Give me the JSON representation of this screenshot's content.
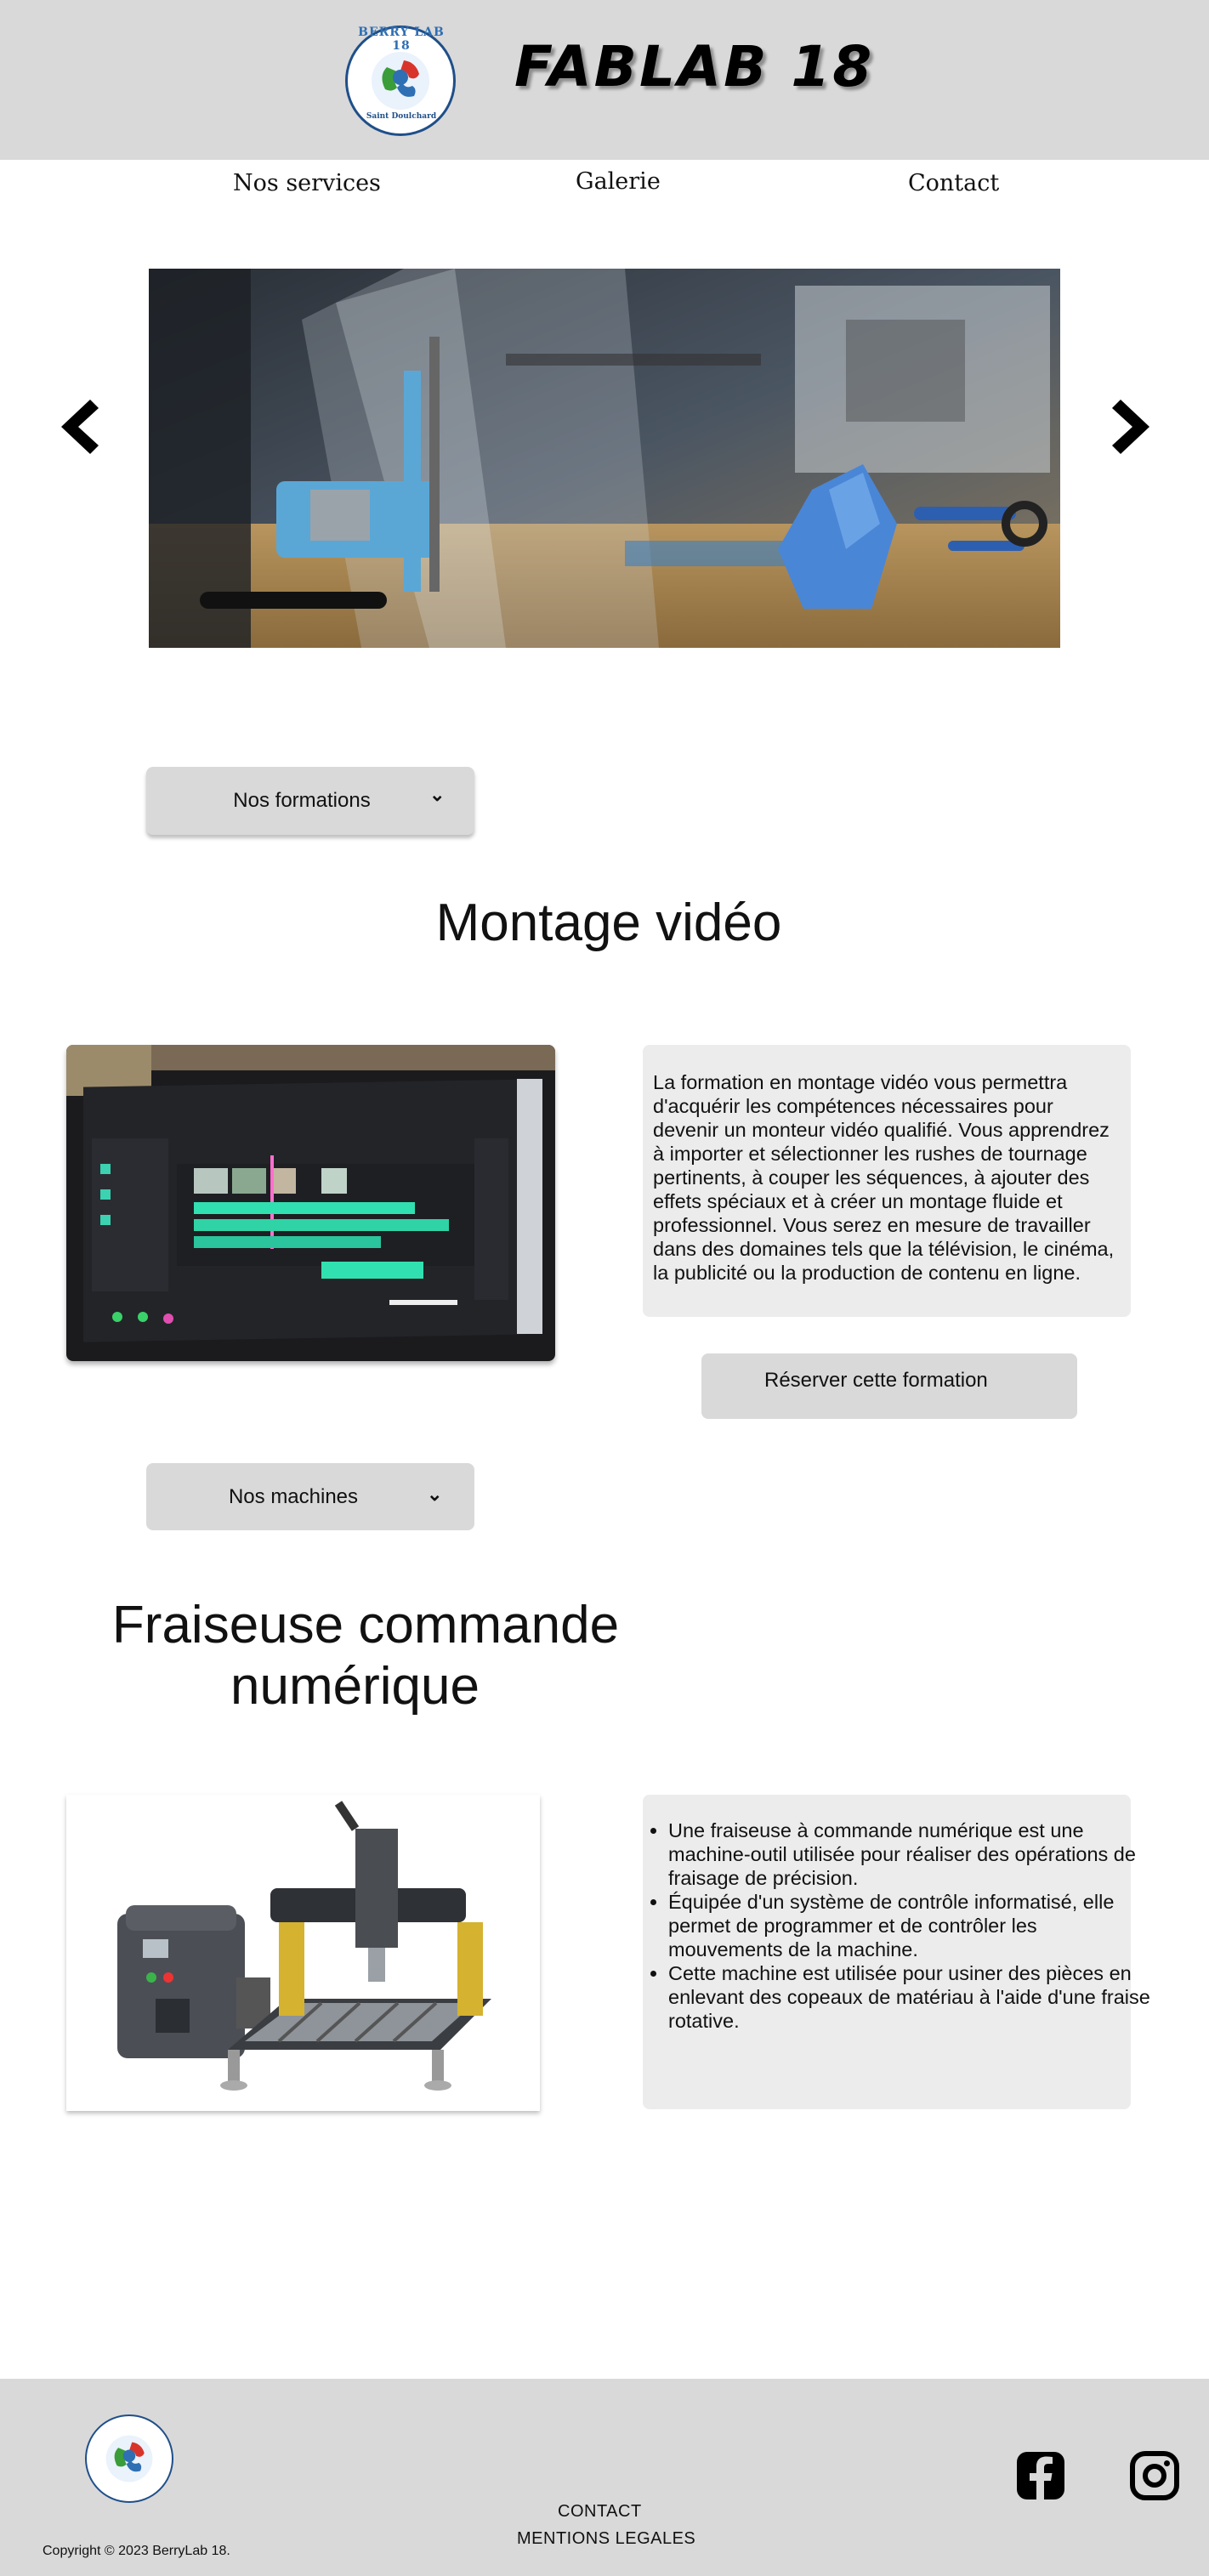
{
  "header": {
    "site_title": "FABLAB 18",
    "logo_text": "BERRY LAB 18",
    "logo_subtext": "Saint Doulchard"
  },
  "nav": {
    "items": [
      "Nos services",
      "Galerie",
      "Contact"
    ]
  },
  "carousel": {
    "image_desc_icon": "3d-printer-photo",
    "prev_icon": "chevron-left-icon",
    "next_icon": "chevron-right-icon"
  },
  "formations": {
    "dropdown_label": "Nos formations",
    "title": "Montage vidéo",
    "text": "La formation en montage vidéo vous permettra d'acquérir les compétences nécessaires pour devenir un monteur vidéo qualifié. Vous apprendrez à importer et sélectionner les rushes de tournage pertinents, à couper les séquences, à ajouter des effets spéciaux et à créer un montage fluide et professionnel.  Vous serez en mesure de travailler dans des domaines tels que la télévision, le cinéma, la publicité ou la production de contenu en ligne.",
    "book_label": "Réserver cette formation"
  },
  "machines": {
    "dropdown_label": "Nos machines",
    "title_line1": "Fraiseuse commande",
    "title_line2": "numérique",
    "bullets": [
      "Une fraiseuse à commande numérique est une machine-outil utilisée pour réaliser des opérations de fraisage de précision.",
      "Équipée d'un système de contrôle informatisé, elle permet de programmer et de contrôler les mouvements de la machine.",
      "Cette machine est utilisée pour usiner des pièces en enlevant des copeaux de matériau à l'aide d'une fraise rotative."
    ]
  },
  "footer": {
    "contact_label": "CONTACT",
    "legal_label": "MENTIONS LEGALES",
    "copyright": "Copyright © 2023 BerryLab 18."
  },
  "colors": {
    "header_bg": "#d9d9d9",
    "card_bg": "#ececec",
    "button_bg": "#d9d9d9"
  }
}
